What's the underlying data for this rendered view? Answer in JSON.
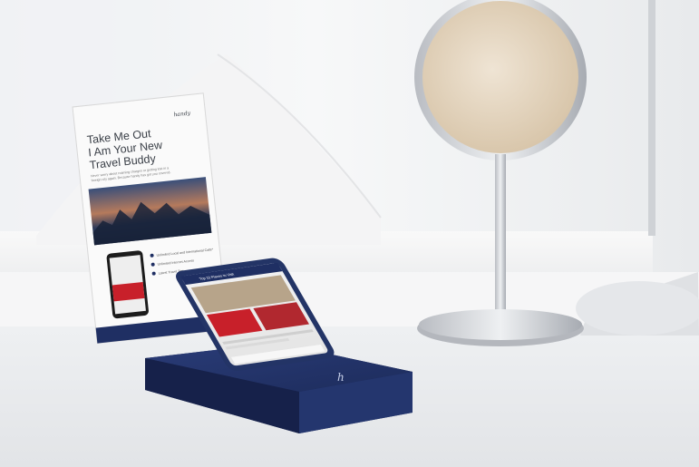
{
  "scene": {
    "card": {
      "brand": "handy",
      "title_lines": [
        "Take Me Out",
        "I Am Your New",
        "Travel Buddy"
      ],
      "subtitle_lines": [
        "Never worry about roaming charges or getting lost in a",
        "foreign city again. Because handy has got you covered."
      ],
      "bullets": [
        "Unlimited Local and International Calls*",
        "Unlimited Internet Access",
        "Latest Travel Tips"
      ]
    },
    "phone": {
      "header_title": "Top 10 Places to Visit"
    },
    "dock": {
      "brand_mark": "h"
    },
    "colors": {
      "dock_navy": "#1f2f63",
      "card_white": "#fafafa",
      "accent_red": "#c8202a",
      "mirror_gold": "#e3d3bd"
    }
  }
}
